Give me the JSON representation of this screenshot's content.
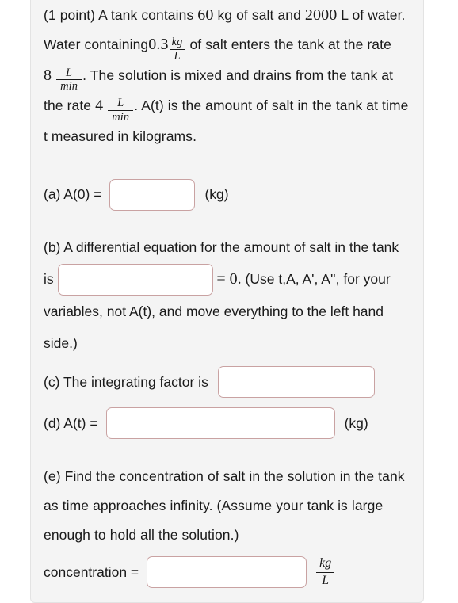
{
  "problem": {
    "points_label": "(1 point)",
    "intro": {
      "seg1": "A tank contains",
      "salt_mass": "60",
      "seg2": "kg of salt and",
      "water_volume": "2000",
      "seg3": "L of water. Water containing",
      "inflow_concentration": "0.3",
      "conc_unit_num": "kg",
      "conc_unit_den": "L",
      "seg4": "of salt enters the tank at the rate",
      "inflow_rate": "8",
      "rate_unit_num": "L",
      "rate_unit_den": "min",
      "seg5": ". The solution is mixed and drains from the tank at the rate",
      "outflow_rate": "4",
      "seg6": ". A(t) is the amount of salt in the tank at time t measured in kilograms."
    },
    "parts": {
      "a": {
        "label": "(a) A(0) =",
        "input_value": "",
        "input_placeholder": "",
        "unit": "(kg)"
      },
      "b": {
        "text_before_box": "(b) A differential equation for the amount of salt in the tank is",
        "input_value": "",
        "input_placeholder": "",
        "equals_zero": "= 0.",
        "text_after_box": "(Use t,A, A', A'', for your variables, not A(t), and move everything to the left hand side.)"
      },
      "c": {
        "label": "(c) The integrating factor is",
        "input_value": "",
        "input_placeholder": ""
      },
      "d": {
        "label": "(d) A(t) =",
        "input_value": "",
        "input_placeholder": "",
        "unit": "(kg)"
      },
      "e": {
        "text": "(e) Find the concentration of salt in the solution in the tank as time approaches infinity. (Assume your tank is large enough to hold all the solution.)",
        "label": "concentration =",
        "input_value": "",
        "input_placeholder": "",
        "unit_num": "kg",
        "unit_den": "L"
      }
    }
  },
  "colors": {
    "panel_background": "#f4f4f4",
    "panel_border": "#e3e3e3",
    "page_background": "#ffffff",
    "input_border": "#c9a2a2",
    "input_background": "#ffffff",
    "text": "#1a1a1a"
  }
}
